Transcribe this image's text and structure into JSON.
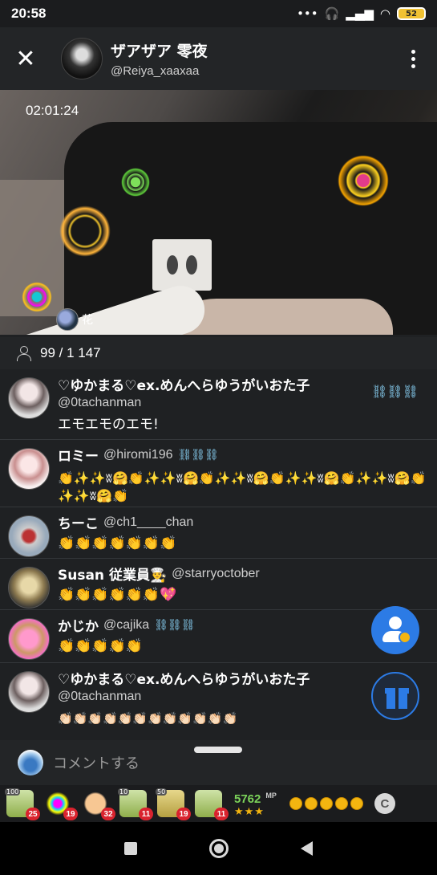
{
  "status_bar": {
    "time": "20:58",
    "icons": [
      "more-dots-icon",
      "headphones-icon",
      "signal-icon",
      "wifi-icon",
      "battery-icon"
    ],
    "battery": "52"
  },
  "header": {
    "host_name": "ザアザア 零夜",
    "host_handle": "@Reiya_xaaxaa",
    "close_label": "✕"
  },
  "video": {
    "elapsed": "02:01:24",
    "gift_sender_label": "花"
  },
  "viewers": {
    "text": "99 / 1 147"
  },
  "comments": [
    {
      "name": "♡ゆかまる♡ex.めんへらゆうがいおた子",
      "handle": "@0tachanman",
      "badge": "⛓⛓⛓",
      "text": "エモエモのエモ!"
    },
    {
      "name": "ロミー",
      "handle": "@hiromi196",
      "badge": "⛓⛓⛓",
      "text": "👏✨✨ʬ🤗👏✨✨ʬ🤗👏✨✨ʬ🤗👏✨✨ʬ🤗👏✨✨ʬ🤗👏✨✨ʬ🤗👏"
    },
    {
      "name": "ちーこ",
      "handle": "@ch1____chan",
      "badge": "",
      "text": "👏👏👏👏👏👏👏"
    },
    {
      "name": "Susan 従業員👨‍🍳",
      "handle": "@starryoctober",
      "badge": "",
      "text": "👏👏👏👏👏👏💖"
    },
    {
      "name": "かじか",
      "handle": "@cajika",
      "badge": "⛓⛓⛓",
      "text": "👏👏👏👏👏"
    },
    {
      "name": "♡ゆかまる♡ex.めんへらゆうがいおた子",
      "handle": "@0tachanman",
      "badge": "",
      "text": "👏🏻👏🏻👏🏻👏🏻👏🏻👏🏻👏🏻👏🏻👏🏻👏🏻👏🏻👏🏻"
    }
  ],
  "comment_input": {
    "placeholder": "コメントする"
  },
  "gift_tray": {
    "items": [
      {
        "icon": "tea-gift-icon",
        "tag": "100",
        "count": "25"
      },
      {
        "icon": "fireworks-gift-icon",
        "tag": "",
        "count": "19"
      },
      {
        "icon": "clap-gift-icon",
        "tag": "",
        "count": "32"
      },
      {
        "icon": "tea-gift-icon",
        "tag": "10",
        "count": "11"
      },
      {
        "icon": "tea-gift-icon",
        "tag": "50",
        "count": "19"
      },
      {
        "icon": "tea-gift-icon",
        "tag": "",
        "count": "11"
      }
    ],
    "mp_value": "5762",
    "mp_unit": "MP",
    "mp_stars": "★★★",
    "c_button": "C"
  },
  "colors": {
    "accent": "#2c7be5",
    "coin": "#f3b510",
    "count_badge": "#d9232e",
    "mp_green": "#7cd35a"
  }
}
